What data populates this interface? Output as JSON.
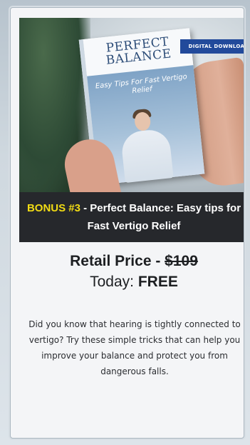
{
  "hero": {
    "badge_text": "DIGITAL DOWNLOAD",
    "book_title_line1": "PERFECT",
    "book_title_line2": "BALANCE",
    "book_subtitle": "Easy Tips For Fast Vertigo Relief"
  },
  "caption": {
    "bonus_label": "BONUS #3",
    "text": " - Perfect Balance: Easy tips for Fast Vertigo Relief"
  },
  "price": {
    "retail_label": "Retail Price - ",
    "retail_amount": "$109",
    "today_label": "Today: ",
    "today_value": "FREE"
  },
  "description": "Did you know that hearing is tightly connected to vertigo? Try these simple tricks that can help you improve your balance and protect you from dangerous falls.",
  "colors": {
    "bonus_yellow": "#f2dc14",
    "caption_bg": "#26282c",
    "badge_blue": "#224a9b"
  }
}
